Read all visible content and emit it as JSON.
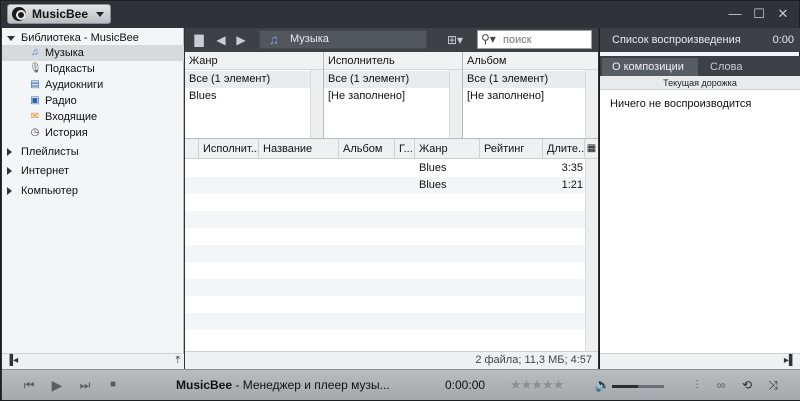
{
  "app": {
    "menu_label": "MusicBee",
    "window_buttons": {
      "minimize": "—",
      "maximize": "☐",
      "close": "✕"
    }
  },
  "sidebar": {
    "library_label": "Библиотека - MusicBee",
    "items": [
      {
        "label": "Музыка",
        "icon": "♫",
        "selected": true
      },
      {
        "label": "Подкасты",
        "icon": "🎙"
      },
      {
        "label": "Аудиокниги",
        "icon": "▤"
      },
      {
        "label": "Радио",
        "icon": "▣"
      },
      {
        "label": "Входящие",
        "icon": "✉"
      },
      {
        "label": "История",
        "icon": "◷"
      }
    ],
    "groups": [
      "Плейлисты",
      "Интернет",
      "Компьютер"
    ]
  },
  "toolbar": {
    "breadcrumb": "Музыка",
    "search_placeholder": "поиск"
  },
  "filters": {
    "columns": [
      {
        "header": "Жанр",
        "all": "Все  (1 элемент)",
        "value": "Blues"
      },
      {
        "header": "Исполнитель",
        "all": "Все  (1 элемент)",
        "value": "[Не заполнено]"
      },
      {
        "header": "Альбом",
        "all": "Все  (1 элемент)",
        "value": "[Не заполнено]"
      }
    ]
  },
  "tracks": {
    "headers": [
      "Исполнит...",
      "Название",
      "Альбом",
      "Г...",
      "Жанр",
      "Рейтинг",
      "Длите..."
    ],
    "rows": [
      {
        "genre": "Blues",
        "duration": "3:35"
      },
      {
        "genre": "Blues",
        "duration": "1:21"
      }
    ]
  },
  "status": {
    "summary": "2 файла; 11,3 МБ; 4:57"
  },
  "right_panel": {
    "header": "Список воспроизведения",
    "header_time": "0:00",
    "tabs": [
      "О композиции",
      "Слова"
    ],
    "subheader": "Текущая дорожка",
    "message": "Ничего не воспроизводится"
  },
  "player": {
    "title_bold": "MusicBee",
    "title_rest": " - Менеджер и плеер музы...",
    "time": "0:00:00",
    "rating_stars": "★★★★★",
    "volume_level": 0.5
  }
}
